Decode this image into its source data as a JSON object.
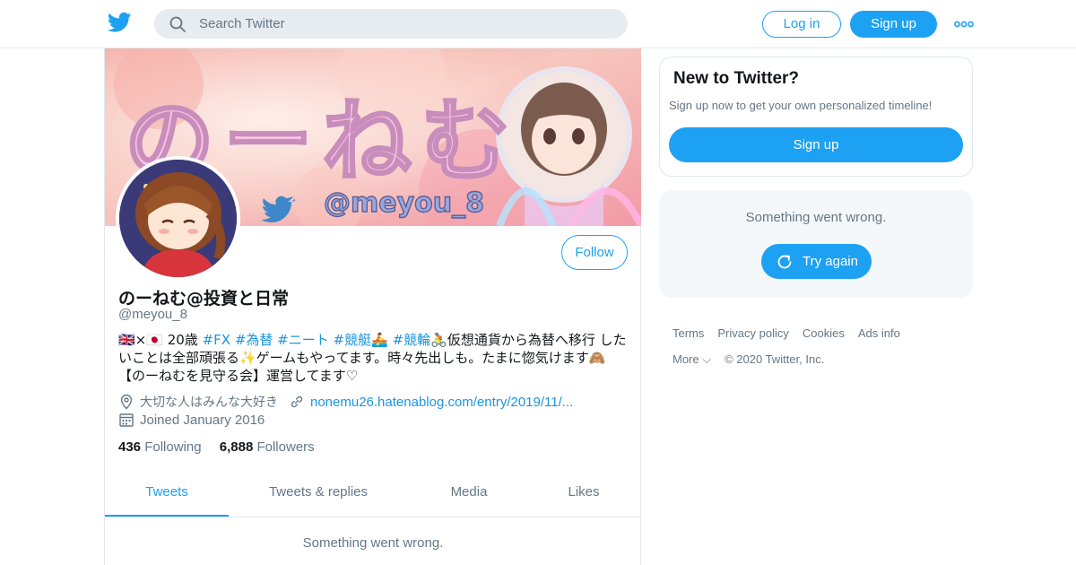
{
  "header": {
    "search_placeholder": "Search Twitter",
    "login_label": "Log in",
    "signup_label": "Sign up",
    "more_icon": "more-dots-icon",
    "brand_color": "#1da1f2"
  },
  "profile": {
    "banner_text": "のーねむ",
    "banner_handle": "@meyou_8",
    "display_name": "のーねむ@投資と日常",
    "handle": "@meyou_8",
    "follow_label": "Follow",
    "bio": {
      "flags": "🇬🇧×🇯🇵",
      "age": " 20歳 ",
      "tag1": "#FX",
      "tag2": "#為替",
      "tag3": "#ニート",
      "tag4": "#競艇",
      "emoji_boat": "🚣",
      "tag5": "#競輪",
      "text1": "🚴仮想通貨から為替へ移行 したいことは全部頑張る✨ゲームもやってます。時々先出しも。たまに惚気けます🙈【のーねむを見守る会】運営してます♡"
    },
    "location": "大切な人はみんな大好き",
    "website": "nonemu26.hatenablog.com/entry/2019/11/...",
    "joined": "Joined January 2016",
    "following_count": "436",
    "following_label": "Following",
    "followers_count": "6,888",
    "followers_label": "Followers",
    "tabs": [
      {
        "label": "Tweets",
        "active": true
      },
      {
        "label": "Tweets & replies",
        "active": false
      },
      {
        "label": "Media",
        "active": false
      },
      {
        "label": "Likes",
        "active": false
      }
    ],
    "error_text": "Something went wrong."
  },
  "sidebar": {
    "new_title": "New to Twitter?",
    "new_subtitle": "Sign up now to get your own personalized timeline!",
    "signup_label": "Sign up",
    "error_text": "Something went wrong.",
    "retry_label": "Try again"
  },
  "footer": {
    "links": [
      "Terms",
      "Privacy policy",
      "Cookies",
      "Ads info"
    ],
    "more_label": "More ⌵",
    "copyright": "© 2020 Twitter, Inc."
  }
}
